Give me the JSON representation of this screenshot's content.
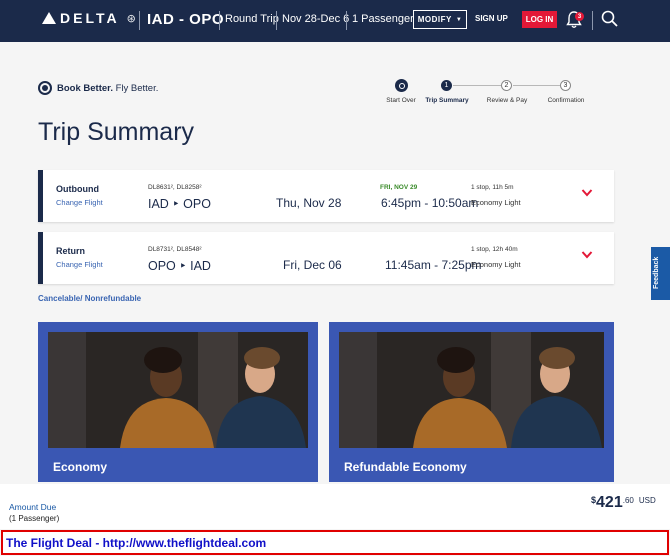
{
  "header": {
    "logo_text": "DELTA",
    "route": "IAD - OPO",
    "trip_type": "Round Trip",
    "dates": "Nov 28-Dec 6",
    "passengers": "1 Passenger",
    "modify_label": "MODIFY",
    "signup_label": "SIGN UP",
    "login_label": "LOG IN",
    "notification_count": "3"
  },
  "brand": {
    "tagline_bold": "Book Better.",
    "tagline_rest": " Fly Better."
  },
  "progress": {
    "steps": [
      {
        "label": "Start Over",
        "marker": ""
      },
      {
        "label": "Trip Summary",
        "marker": "1"
      },
      {
        "label": "Review & Pay",
        "marker": "2"
      },
      {
        "label": "Confirmation",
        "marker": "3"
      }
    ]
  },
  "page_title": "Trip Summary",
  "flights": [
    {
      "direction": "Outbound",
      "change_label": "Change Flight",
      "flight_numbers": "DL8631², DL8258²",
      "route": "IAD ‣ OPO",
      "date": "Thu, Nov 28",
      "date_note": "FRI, NOV 29",
      "times": "6:45pm - 10:50am",
      "stops": "1 stop, 11h 5m",
      "cabin": "Economy Light"
    },
    {
      "direction": "Return",
      "change_label": "Change Flight",
      "flight_numbers": "DL8731², DL8548²",
      "route": "OPO ‣ IAD",
      "date": "Fri, Dec 06",
      "date_note": "",
      "times": "11:45am - 7:25pm",
      "stops": "1 stop, 12h 40m",
      "cabin": "Economy Light"
    }
  ],
  "cancel_note": "Cancelable/ Nonrefundable",
  "fares": [
    {
      "name": "Economy"
    },
    {
      "name": "Refundable Economy"
    }
  ],
  "summary": {
    "amount_label": "Amount Due",
    "passengers": "(1 Passenger)",
    "currency_symbol": "$",
    "price_main": "421",
    "price_decimal": ".60",
    "currency_code": "USD"
  },
  "watermark": "The Flight Deal - http://www.theflightdeal.com",
  "feedback_label": "Feedback",
  "colors": {
    "navy": "#1b2a4a",
    "red": "#e31837",
    "link_blue": "#3a65b2",
    "fare_blue": "#3a57b3"
  }
}
